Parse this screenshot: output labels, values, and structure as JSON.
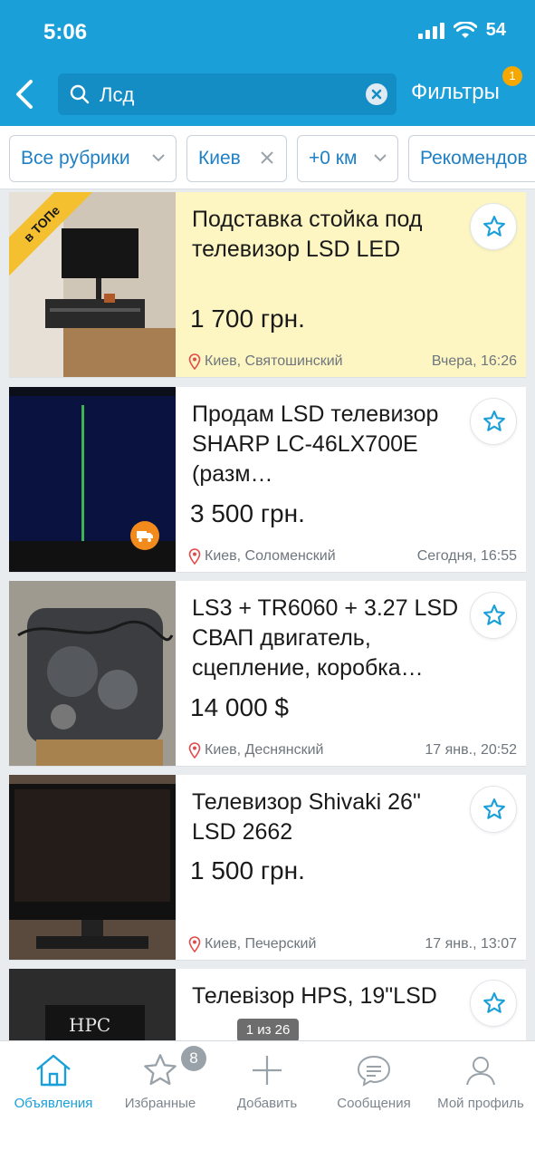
{
  "status": {
    "time": "5:06",
    "battery": "54"
  },
  "header": {
    "search_query": "Лсд",
    "filters_label": "Фильтры",
    "filters_count": "1"
  },
  "chips": [
    {
      "label": "Все рубрики"
    },
    {
      "label": "Киев"
    },
    {
      "label": "+0 км"
    },
    {
      "label": "Рекомендов"
    }
  ],
  "listings": [
    {
      "title": "Подставка стойка под телевизор LSD LED",
      "price": "1 700 грн.",
      "location": "Киев, Святошинский",
      "date": "Вчера, 16:26",
      "badge": "в ТОПе"
    },
    {
      "title": "Продам LSD телевизор SHARP LC-46LX700E (разм…",
      "price": "3 500 грн.",
      "location": "Киев, Соломенский",
      "date": "Сегодня, 16:55"
    },
    {
      "title": "LS3 + TR6060 + 3.27 LSD СВАП двигатель, сцепление, коробка…",
      "price": "14 000 $",
      "location": "Киев, Деснянский",
      "date": "17 янв., 20:52"
    },
    {
      "title": "Телевизор Shivaki 26\" LSD 2662",
      "price": "1 500 грн.",
      "location": "Киев, Печерский",
      "date": "17 янв., 13:07"
    },
    {
      "title": "Телевізор HPS, 19\"LSD",
      "img_text": "HPC"
    }
  ],
  "pager": "1 из 26",
  "tabbar": {
    "items": [
      {
        "label": "Объявления",
        "icon": "home-icon"
      },
      {
        "label": "Избранные",
        "icon": "star-icon",
        "badge": "8"
      },
      {
        "label": "Добавить",
        "icon": "plus-icon"
      },
      {
        "label": "Сообщения",
        "icon": "chat-icon"
      },
      {
        "label": "Мой профиль",
        "icon": "profile-icon"
      }
    ]
  },
  "colors": {
    "accent": "#1b9fd9",
    "top_bg": "#fdf6c3",
    "badge": "#f7a800"
  }
}
